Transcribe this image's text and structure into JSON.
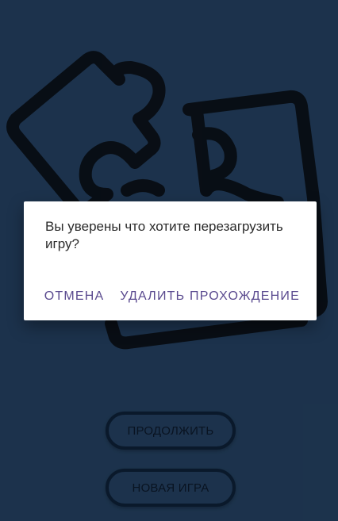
{
  "menu": {
    "continue_label": "ПРОДОЛЖИТЬ",
    "new_game_label": "НОВАЯ ИГРА"
  },
  "dialog": {
    "message": "Вы уверены что хотите перезагрузить игру?",
    "cancel_label": "ОТМЕНА",
    "delete_label": "УДАЛИТЬ ПРОХОЖДЕНИЕ"
  },
  "logo": {
    "icon": "puzzle-icon"
  },
  "colors": {
    "background": "#203a57",
    "outline": "#0c1d31",
    "dialog_background": "#ffffff",
    "accent": "#5a4a8f"
  }
}
